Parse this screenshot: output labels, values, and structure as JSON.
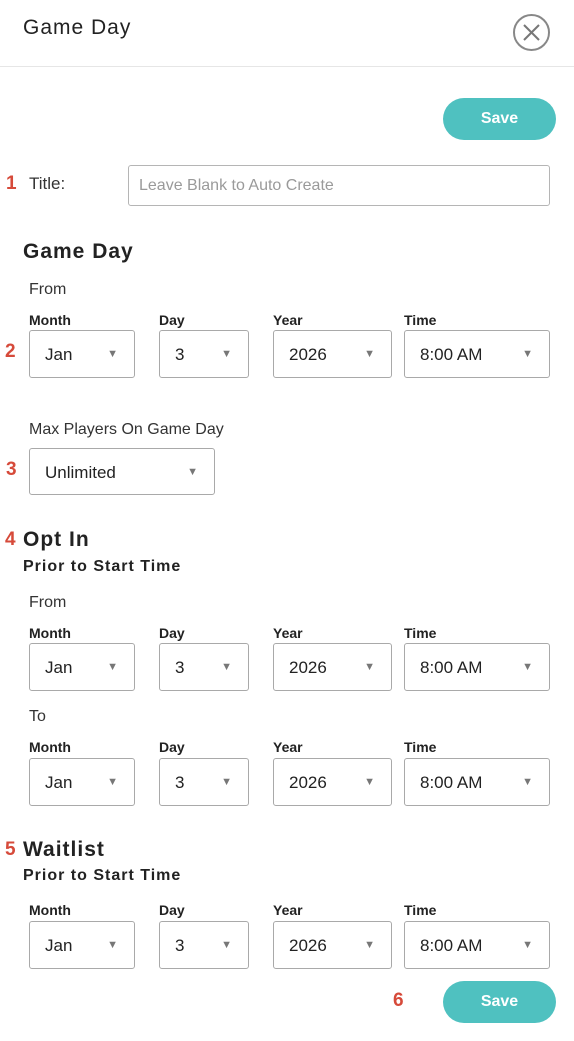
{
  "header": {
    "title": "Game Day"
  },
  "buttons": {
    "save_top": "Save",
    "save_bottom": "Save"
  },
  "markers": [
    "1",
    "2",
    "3",
    "4",
    "5",
    "6"
  ],
  "title_field": {
    "label": "Title:",
    "placeholder": "Leave Blank to Auto Create",
    "value": ""
  },
  "game_day": {
    "heading": "Game Day",
    "from_label": "From",
    "labels": {
      "month": "Month",
      "day": "Day",
      "year": "Year",
      "time": "Time"
    },
    "from": {
      "month": "Jan",
      "day": "3",
      "year": "2026",
      "time": "8:00 AM"
    }
  },
  "max_players": {
    "label": "Max Players On Game Day",
    "value": "Unlimited"
  },
  "opt_in": {
    "heading": "Opt In",
    "subheading": "Prior to Start Time",
    "from_label": "From",
    "to_label": "To",
    "labels": {
      "month": "Month",
      "day": "Day",
      "year": "Year",
      "time": "Time"
    },
    "from": {
      "month": "Jan",
      "day": "3",
      "year": "2026",
      "time": "8:00 AM"
    },
    "to": {
      "month": "Jan",
      "day": "3",
      "year": "2026",
      "time": "8:00 AM"
    }
  },
  "waitlist": {
    "heading": "Waitlist",
    "subheading": "Prior to Start Time",
    "labels": {
      "month": "Month",
      "day": "Day",
      "year": "Year",
      "time": "Time"
    },
    "from": {
      "month": "Jan",
      "day": "3",
      "year": "2026",
      "time": "8:00 AM"
    }
  },
  "colors": {
    "accent": "#4fc1c0",
    "marker": "#d64a3a"
  },
  "icons": {
    "close": "close-icon",
    "dropdown": "caret-down-icon"
  }
}
